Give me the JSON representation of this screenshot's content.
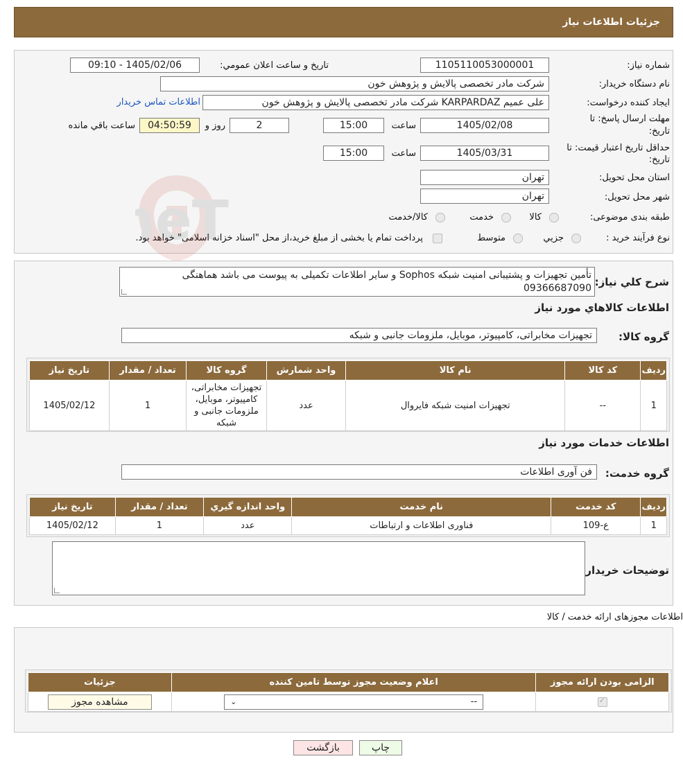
{
  "header": {
    "title": "جزئیات اطلاعات نیاز"
  },
  "info": {
    "need_number_label": "شماره نیاز:",
    "need_number": "1105110053000001",
    "announce_label": "تاریخ و ساعت اعلان عمومي:",
    "announce_value": "1405/02/06 - 09:10",
    "buyer_org_label": "نام دستگاه خريدار:",
    "buyer_org": "شرکت مادر تخصصی پالایش و پژوهش خون",
    "creator_label": "ايجاد کننده درخواست:",
    "creator": "علی عمیم KARPARDAZ شرکت مادر تخصصی پالایش و پژوهش خون",
    "contact_link": "اطلاعات تماس خريدار",
    "deadline_label_1": "مهلت ارسال پاسخ: تا",
    "deadline_label_2": "تاریخ:",
    "deadline_date": "1405/02/08",
    "time_label": "ساعت",
    "deadline_time": "15:00",
    "days_value": "2",
    "days_label": "روز و",
    "remaining_time": "04:50:59",
    "remaining_label": "ساعت باقي مانده",
    "validity_label_1": "حداقل تاريخ اعتبار قيمت: تا",
    "validity_label_2": "تاريخ:",
    "validity_date": "1405/03/31",
    "validity_time": "15:00",
    "province_label": "استان محل تحويل:",
    "province": "تهران",
    "city_label": "شهر محل تحويل:",
    "city": "تهران",
    "category_label": "طبقه بندی موضوعی:",
    "category_options": [
      "کالا",
      "خدمت",
      "کالا/خدمت"
    ],
    "process_label": "نوع فرآيند خريد :",
    "process_options": [
      "جزيي",
      "متوسط"
    ],
    "process_note": "پرداخت تمام یا بخشی از مبلغ خرید،از محل \"اسناد خزانه اسلامی\" خواهد بود."
  },
  "description": {
    "label": "شرح کلي نياز:",
    "text_line1": "تأمین تجهیزات و پشتیبانی امنیت شبکه Sophos و سایر اطلاعات تکمیلی به پیوست می باشد هماهنگی",
    "text_line2": "09366687090"
  },
  "goods": {
    "section_title": "اطلاعات کالاهاي مورد نياز",
    "group_label": "گروه کالا:",
    "group_value": "تجهیزات مخابراتی، کامپیوتر، موبایل، ملزومات جانبی و شبکه",
    "columns": [
      "رديف",
      "کد کالا",
      "نام کالا",
      "واحد شمارش",
      "گروه کالا",
      "تعداد / مقدار",
      "تاريخ نياز"
    ],
    "rows": [
      {
        "row": "1",
        "code": "--",
        "name": "تجهیزات امنیت شبکه فایروال",
        "unit": "عدد",
        "group": "تجهیزات مخابراتی، کامپیوتر، موبایل، ملزومات جانبی و شبکه",
        "qty": "1",
        "date": "1405/02/12"
      }
    ]
  },
  "services": {
    "section_title": "اطلاعات خدمات مورد نياز",
    "group_label": "گروه خدمت:",
    "group_value": "فن آوری اطلاعات",
    "columns": [
      "رديف",
      "کد خدمت",
      "نام خدمت",
      "واحد اندازه گيري",
      "تعداد / مقدار",
      "تاريخ نياز"
    ],
    "rows": [
      {
        "row": "1",
        "code": "ع-109",
        "name": "فناوری اطلاعات و ارتباطات",
        "unit": "عدد",
        "qty": "1",
        "date": "1405/02/12"
      }
    ]
  },
  "buyer_notes": {
    "label": "توضيحات خريدار:"
  },
  "licenses": {
    "section_title": "اطلاعات مجوزهای ارائه خدمت / کالا",
    "columns": [
      "الزامی بودن ارائه مجوز",
      "اعلام وضعیت مجوز توسط تامین کننده",
      "جزئیات"
    ],
    "select_value": "--",
    "view_button": "مشاهده مجوز"
  },
  "actions": {
    "print": "چاپ",
    "back": "بازگشت"
  },
  "watermark": {
    "text": "AriaTender.neT"
  }
}
